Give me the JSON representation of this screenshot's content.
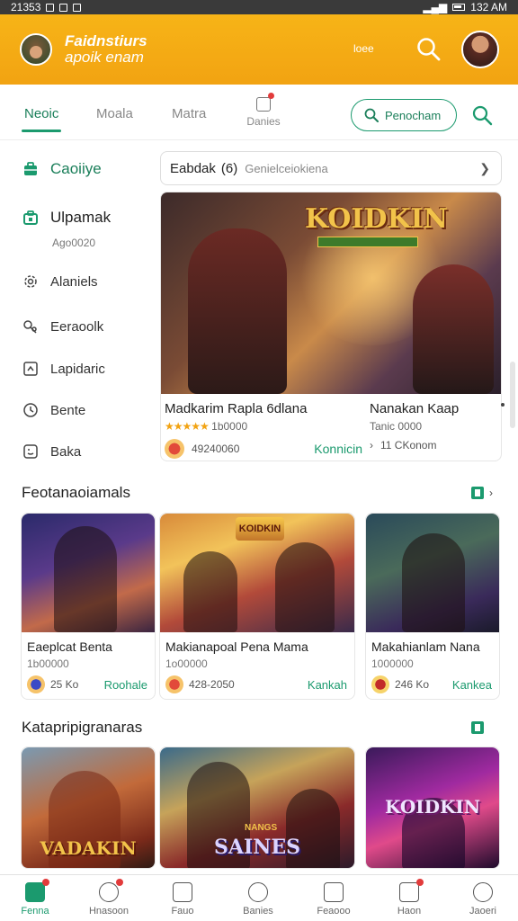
{
  "status_bar": {
    "left_text": "21353",
    "right_text": "132 AM"
  },
  "header": {
    "brand_line1": "Faidnstiurs",
    "brand_line2": "apoik enam",
    "link_label": "loee"
  },
  "tabs": {
    "items": [
      {
        "label": "Neoic"
      },
      {
        "label": "Moala"
      },
      {
        "label": "Matra"
      }
    ],
    "games_label": "Danies",
    "pill_label": "Penocham"
  },
  "sidebar": {
    "items": [
      {
        "label": "Caoiiye"
      },
      {
        "label": "Ulpamak",
        "sub": "Ago0020"
      },
      {
        "label": "Alaniels"
      },
      {
        "label": "Eeraoolk"
      },
      {
        "label": "Lapidaric"
      },
      {
        "label": "Bente"
      },
      {
        "label": "Baka"
      }
    ]
  },
  "search": {
    "value": "Eabdak",
    "icon_text": "(6)",
    "placeholder": "Genielceiokiena"
  },
  "hero": {
    "logo": "KOIDKIN",
    "left_title": "Madkarim Rapla 6dlana",
    "left_stars": "★★★★★",
    "left_meta": "1b0000",
    "left_count": "49240060",
    "left_action": "Konnicin",
    "right_title": "Nanakan Kaap",
    "right_meta": "Tanic 0000",
    "right_count": "11 CKonom"
  },
  "sections": [
    {
      "title": "Feotanaoiamals",
      "cards": [
        {
          "name": "Eaeplcat Benta",
          "meta": "1b00000",
          "count": "25 Ko",
          "action": "Roohale"
        },
        {
          "name": "Makianapoal Pena Mama",
          "meta": "1o00000",
          "count": "428-2050",
          "action": "Kankah",
          "badge": "KOIDKIN"
        },
        {
          "name": "Makahianlam Nana",
          "meta": "1000000",
          "count": "246 Ko",
          "action": "Kankea"
        }
      ]
    },
    {
      "title": "Katapripigranaras",
      "cards": [
        {
          "logo": "VADAKIN"
        },
        {
          "logo": "SAINES",
          "badge": "NANGS"
        },
        {
          "logo": "KOIDKIN"
        }
      ]
    }
  ],
  "bottom_nav": [
    {
      "label": "Fenna"
    },
    {
      "label": "Hnasoon"
    },
    {
      "label": "Fauo"
    },
    {
      "label": "Banies"
    },
    {
      "label": "Feaooo"
    },
    {
      "label": "Haon"
    },
    {
      "label": "Jaoeri"
    }
  ]
}
